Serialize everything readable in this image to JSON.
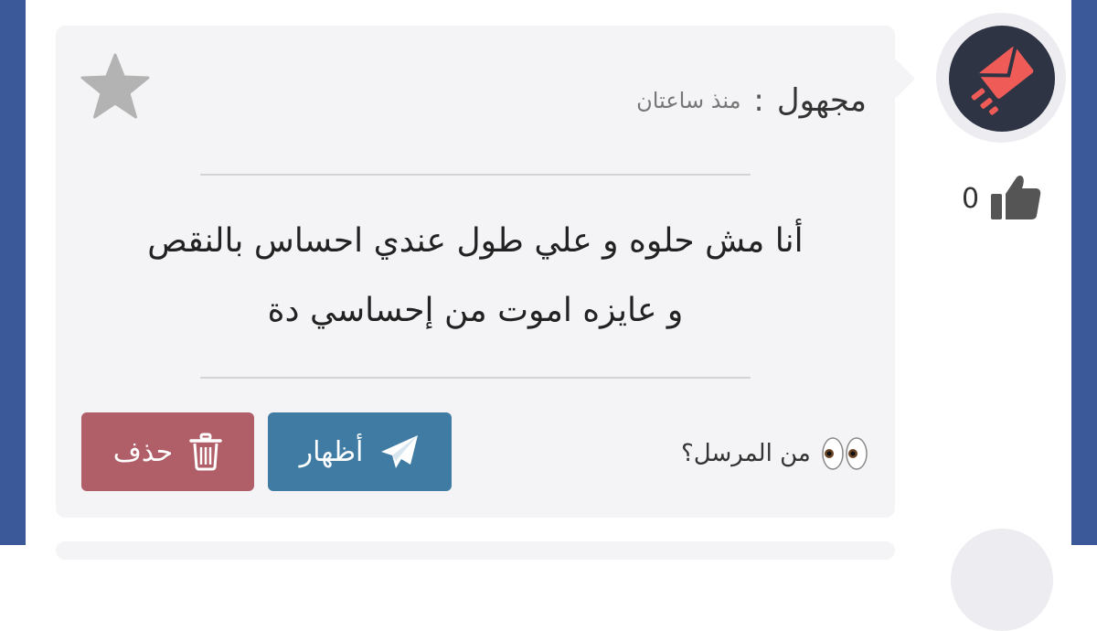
{
  "post": {
    "sender": "مجهول",
    "separator": ":",
    "time": "منذ ساعتان",
    "message_line1": "أنا مش حلوه و علي طول عندي احساس بالنقص",
    "message_line2": "و عايزه اموت من إحساسي دة",
    "likes": "0",
    "who_sent_label": "من المرسل؟",
    "eyes_emoji": "👀",
    "show_button_label": "أظهار",
    "delete_button_label": "حذف"
  },
  "colors": {
    "frame": "#3b5998",
    "card_bg": "#f4f4f7",
    "show_button": "#3f7ba2",
    "delete_button": "#b05e67",
    "avatar_bg": "#2e3443",
    "avatar_logo": "#ef5b57",
    "star": "#b3b3b3",
    "like_icon": "#555555"
  },
  "icons": {
    "avatar": "envelope-logo-icon",
    "favorite": "star-icon",
    "like": "thumbs-up-icon",
    "show": "paper-plane-icon",
    "delete": "trash-icon"
  }
}
